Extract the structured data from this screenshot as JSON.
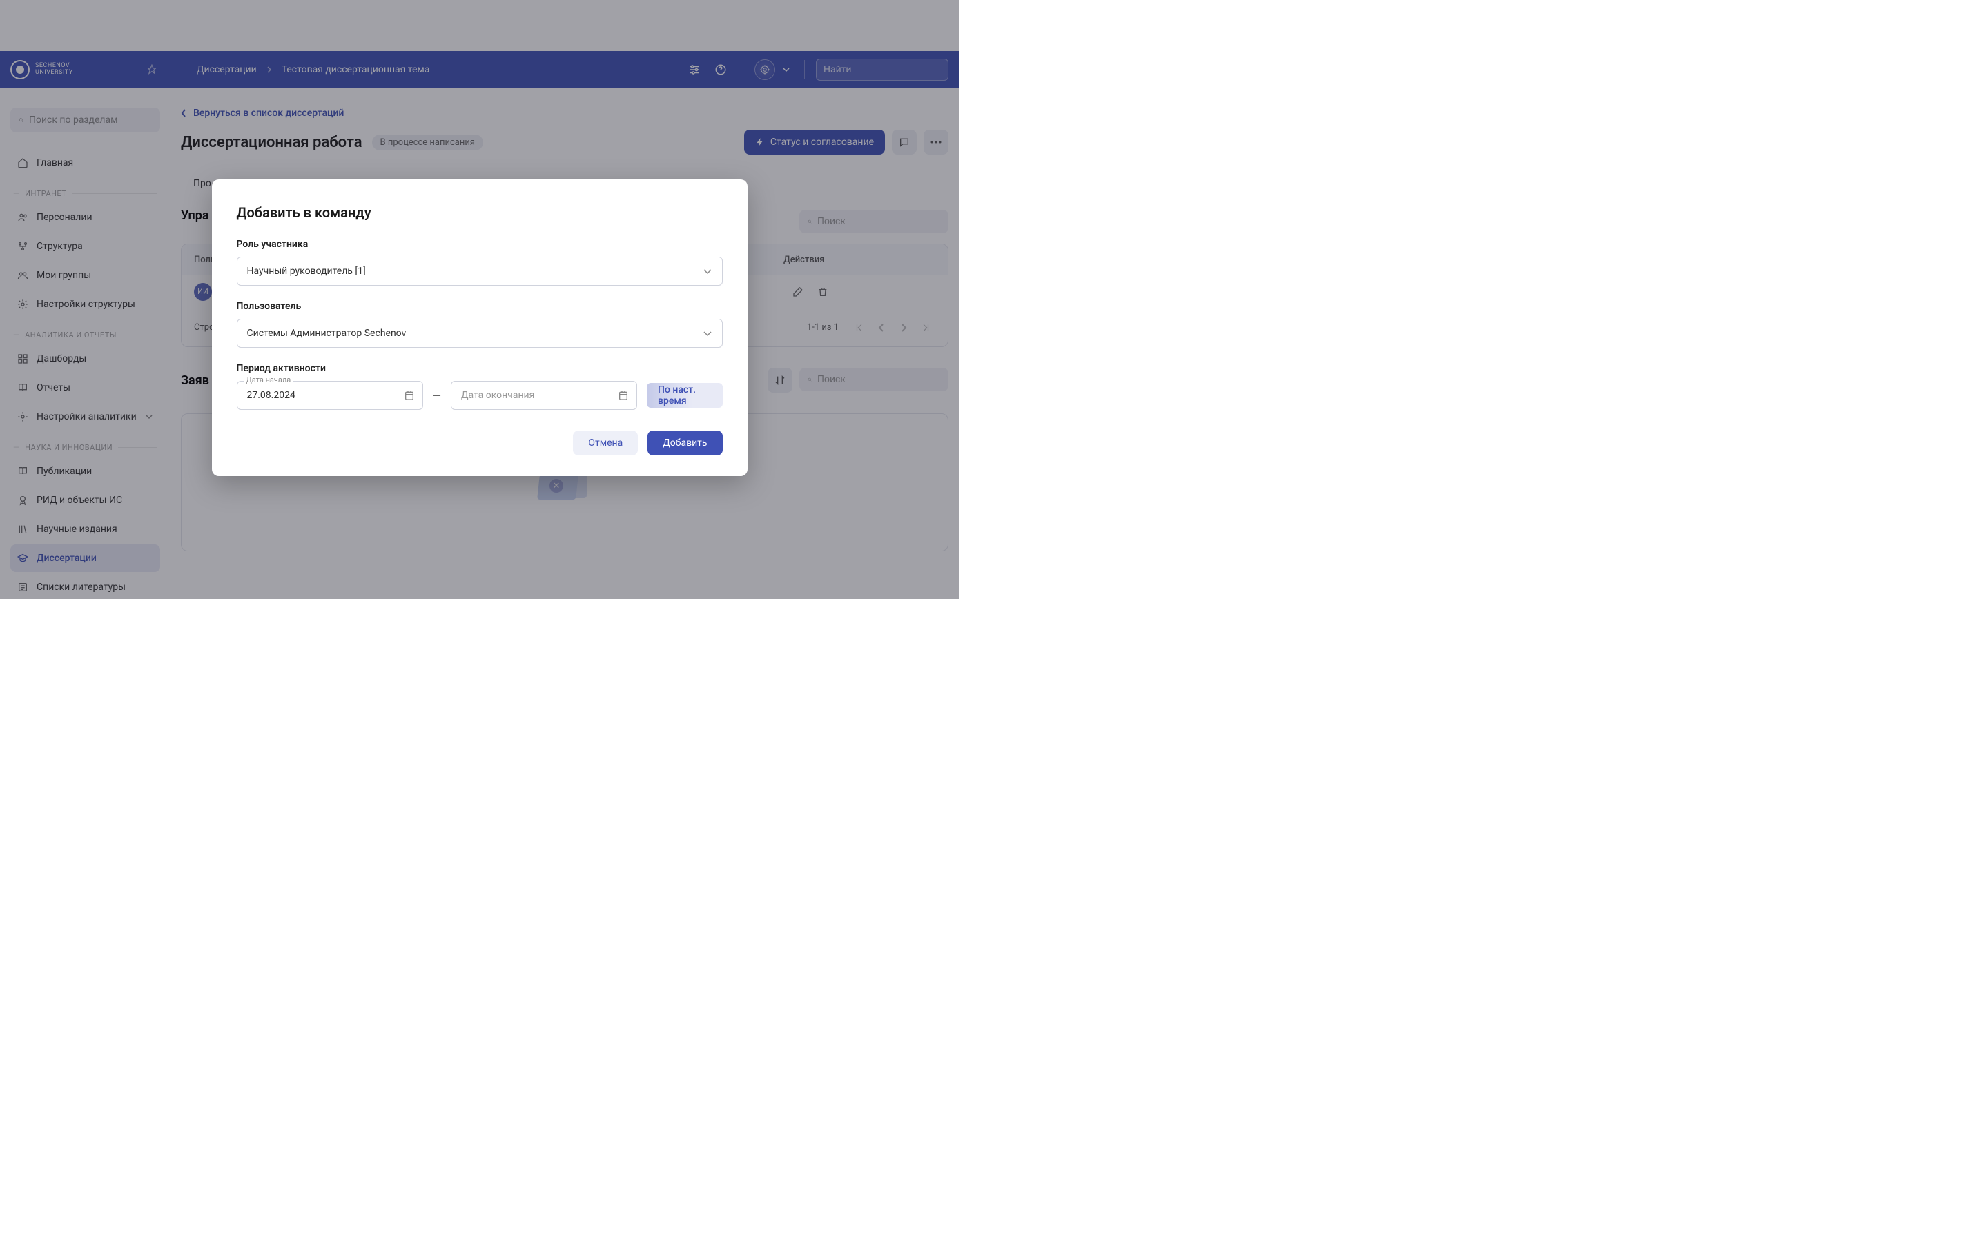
{
  "header": {
    "logo_line1": "SECHENOV",
    "logo_line2": "UNIVERSITY",
    "breadcrumb": [
      "Диссертации",
      "Тестовая диссертационная тема"
    ],
    "search_placeholder": "Найти"
  },
  "sidebar": {
    "search_placeholder": "Поиск по разделам",
    "home": "Главная",
    "sections": [
      {
        "label": "ИНТРАНЕТ",
        "items": [
          "Персоналии",
          "Структура",
          "Мои группы",
          "Настройки структуры"
        ]
      },
      {
        "label": "АНАЛИТИКА И ОТЧЕТЫ",
        "items": [
          "Дашборды",
          "Отчеты",
          "Настройки аналитики"
        ]
      },
      {
        "label": "НАУКА И ИННОВАЦИИ",
        "items": [
          "Публикации",
          "РИД и объекты ИС",
          "Научные издания",
          "Диссертации",
          "Списки литературы"
        ]
      }
    ],
    "active": "Диссертации"
  },
  "main": {
    "back": "Вернуться в список диссертаций",
    "title": "Диссертационная работа",
    "status": "В процессе написания",
    "action_status": "Статус и согласование",
    "tabs_first": "Про",
    "team_heading": "Упра",
    "mini_search_placeholder": "Поиск",
    "table": {
      "col_user": "Поль",
      "col_actions": "Действия",
      "avatar_initials": "ИИ",
      "foot_left": "Строк",
      "foot_right": "1-1 из 1"
    },
    "requests_heading": "Заяв",
    "lower_search_placeholder": "Поиск"
  },
  "modal": {
    "title": "Добавить в команду",
    "role_label": "Роль участника",
    "role_value": "Научный руководитель [1]",
    "user_label": "Пользователь",
    "user_value": "Системы Администратор Sechenov",
    "period_label": "Период активности",
    "start_float": "Дата начала",
    "start_value": "27.08.2024",
    "end_placeholder": "Дата окончания",
    "present_toggle": "По наст. время",
    "cancel": "Отмена",
    "submit": "Добавить"
  }
}
